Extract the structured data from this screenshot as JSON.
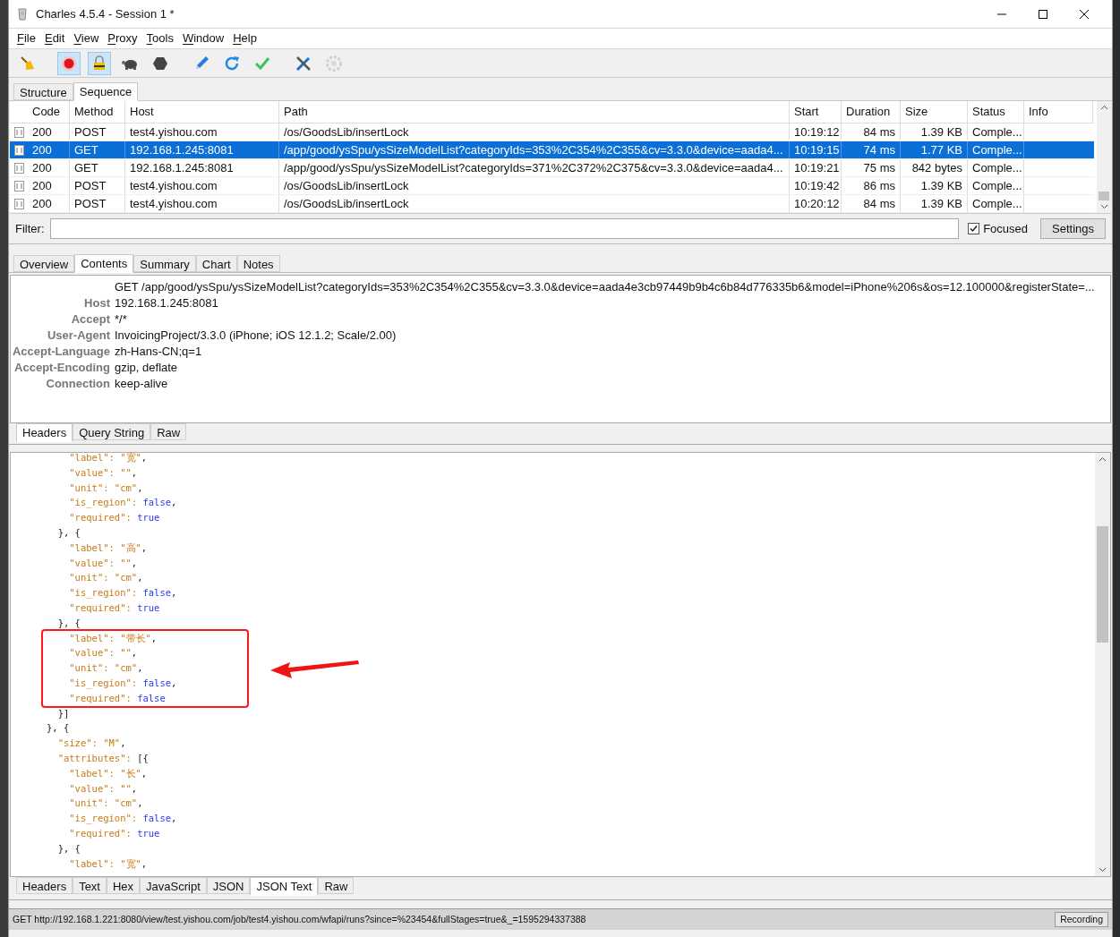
{
  "window": {
    "title": "Charles 4.5.4 - Session 1 *"
  },
  "menu": [
    {
      "label": "File"
    },
    {
      "label": "Edit"
    },
    {
      "label": "View"
    },
    {
      "label": "Proxy"
    },
    {
      "label": "Tools"
    },
    {
      "label": "Window"
    },
    {
      "label": "Help"
    }
  ],
  "toolbar": [
    {
      "kind": "broom",
      "selected": false,
      "disabled": false
    },
    {
      "kind": "record",
      "selected": true,
      "disabled": false
    },
    {
      "kind": "throttle",
      "selected": true,
      "disabled": false
    },
    {
      "kind": "turtle",
      "selected": false,
      "disabled": false
    },
    {
      "kind": "stop",
      "selected": false,
      "disabled": false
    },
    {
      "kind": "pen",
      "selected": false,
      "disabled": false
    },
    {
      "kind": "refresh",
      "selected": false,
      "disabled": false
    },
    {
      "kind": "check",
      "selected": false,
      "disabled": false
    },
    {
      "kind": "tools",
      "selected": false,
      "disabled": false
    },
    {
      "kind": "gear",
      "selected": false,
      "disabled": true
    }
  ],
  "view_tabs": [
    {
      "label": "Structure",
      "selected": false
    },
    {
      "label": "Sequence",
      "selected": true
    }
  ],
  "table": {
    "columns": [
      "Code",
      "Method",
      "Host",
      "Path",
      "Start",
      "Duration",
      "Size",
      "Status",
      "Info"
    ],
    "rows": [
      {
        "selected": false,
        "cells": [
          "200",
          "POST",
          "test4.yishou.com",
          "/os/GoodsLib/insertLock",
          "10:19:12",
          "84 ms",
          "1.39 KB",
          "Comple..."
        ]
      },
      {
        "selected": true,
        "cells": [
          "200",
          "GET",
          "192.168.1.245:8081",
          "/app/good/ysSpu/ysSizeModelList?categoryIds=353%2C354%2C355&cv=3.3.0&device=aada4...",
          "10:19:15",
          "74 ms",
          "1.77 KB",
          "Comple..."
        ]
      },
      {
        "selected": false,
        "cells": [
          "200",
          "GET",
          "192.168.1.245:8081",
          "/app/good/ysSpu/ysSizeModelList?categoryIds=371%2C372%2C375&cv=3.3.0&device=aada4...",
          "10:19:21",
          "75 ms",
          "842 bytes",
          "Comple..."
        ]
      },
      {
        "selected": false,
        "cells": [
          "200",
          "POST",
          "test4.yishou.com",
          "/os/GoodsLib/insertLock",
          "10:19:42",
          "86 ms",
          "1.39 KB",
          "Comple..."
        ]
      },
      {
        "selected": false,
        "cells": [
          "200",
          "POST",
          "test4.yishou.com",
          "/os/GoodsLib/insertLock",
          "10:20:12",
          "84 ms",
          "1.39 KB",
          "Comple..."
        ]
      }
    ]
  },
  "filter": {
    "label": "Filter:",
    "focused": {
      "label": "Focused",
      "checked": true
    },
    "settings_button": "Settings"
  },
  "detail_tabs": [
    {
      "label": "Overview",
      "selected": false
    },
    {
      "label": "Contents",
      "selected": true
    },
    {
      "label": "Summary",
      "selected": false
    },
    {
      "label": "Chart",
      "selected": false
    },
    {
      "label": "Notes",
      "selected": false
    }
  ],
  "request_headers": [
    {
      "value": "GET /app/good/ysSpu/ysSizeModelList?categoryIds=353%2C354%2C355&cv=3.3.0&device=aada4e3cb97449b9b4c6b84d776335b6&model=iPhone%206s&os=12.100000&registerState=..."
    },
    {
      "name": "Host",
      "value": "192.168.1.245:8081"
    },
    {
      "name": "Accept",
      "value": "*/*"
    },
    {
      "name": "User-Agent",
      "value": "InvoicingProject/3.3.0 (iPhone; iOS 12.1.2; Scale/2.00)"
    },
    {
      "name": "Accept-Language",
      "value": "zh-Hans-CN;q=1"
    },
    {
      "name": "Accept-Encoding",
      "value": "gzip, deflate"
    },
    {
      "name": "Connection",
      "value": "keep-alive"
    }
  ],
  "request_tabs": [
    {
      "label": "Headers",
      "selected": true
    },
    {
      "label": "Query String",
      "selected": false
    },
    {
      "label": "Raw",
      "selected": false
    }
  ],
  "code_blocks": [
    {
      "highlighted": false,
      "lines": [
        [
          {
            "kind": "str",
            "text": "    \"label\": \"宽\""
          },
          {
            "kind": "punct",
            "text": ","
          }
        ],
        [
          {
            "kind": "str",
            "text": "    \"value\": \"\""
          },
          {
            "kind": "punct",
            "text": ","
          }
        ],
        [
          {
            "kind": "str",
            "text": "    \"unit\": \"cm\""
          },
          {
            "kind": "punct",
            "text": ","
          }
        ],
        [
          {
            "kind": "str",
            "text": "    \"is_region\": "
          },
          {
            "kind": "bool",
            "text": "false"
          },
          {
            "kind": "punct",
            "text": ","
          }
        ],
        [
          {
            "kind": "str",
            "text": "    \"required\": "
          },
          {
            "kind": "bool",
            "text": "true"
          }
        ],
        [
          {
            "kind": "punct",
            "text": "  }, {"
          }
        ],
        [
          {
            "kind": "str",
            "text": "    \"label\": \"高\""
          },
          {
            "kind": "punct",
            "text": ","
          }
        ],
        [
          {
            "kind": "str",
            "text": "    \"value\": \"\""
          },
          {
            "kind": "punct",
            "text": ","
          }
        ],
        [
          {
            "kind": "str",
            "text": "    \"unit\": \"cm\""
          },
          {
            "kind": "punct",
            "text": ","
          }
        ],
        [
          {
            "kind": "str",
            "text": "    \"is_region\": "
          },
          {
            "kind": "bool",
            "text": "false"
          },
          {
            "kind": "punct",
            "text": ","
          }
        ],
        [
          {
            "kind": "str",
            "text": "    \"required\": "
          },
          {
            "kind": "bool",
            "text": "true"
          }
        ],
        [
          {
            "kind": "punct",
            "text": "  }, {"
          }
        ]
      ]
    },
    {
      "highlighted": true,
      "lines": [
        [
          {
            "kind": "str",
            "text": "    \"label\": \"带长\""
          },
          {
            "kind": "punct",
            "text": ","
          }
        ],
        [
          {
            "kind": "str",
            "text": "    \"value\": \"\""
          },
          {
            "kind": "punct",
            "text": ","
          }
        ],
        [
          {
            "kind": "str",
            "text": "    \"unit\": \"cm\""
          },
          {
            "kind": "punct",
            "text": ","
          }
        ],
        [
          {
            "kind": "str",
            "text": "    \"is_region\": "
          },
          {
            "kind": "bool",
            "text": "false"
          },
          {
            "kind": "punct",
            "text": ","
          }
        ],
        [
          {
            "kind": "str",
            "text": "    \"required\": "
          },
          {
            "kind": "bool",
            "text": "false"
          }
        ]
      ]
    },
    {
      "highlighted": false,
      "lines": [
        [
          {
            "kind": "punct",
            "text": "  }]"
          }
        ],
        [
          {
            "kind": "punct",
            "text": "}, {"
          }
        ],
        [
          {
            "kind": "str",
            "text": "  \"size\": \"M\""
          },
          {
            "kind": "punct",
            "text": ","
          }
        ],
        [
          {
            "kind": "str",
            "text": "  \"attributes\": "
          },
          {
            "kind": "punct",
            "text": "[{"
          }
        ],
        [
          {
            "kind": "str",
            "text": "    \"label\": \"长\""
          },
          {
            "kind": "punct",
            "text": ","
          }
        ],
        [
          {
            "kind": "str",
            "text": "    \"value\": \"\""
          },
          {
            "kind": "punct",
            "text": ","
          }
        ],
        [
          {
            "kind": "str",
            "text": "    \"unit\": \"cm\""
          },
          {
            "kind": "punct",
            "text": ","
          }
        ],
        [
          {
            "kind": "str",
            "text": "    \"is_region\": "
          },
          {
            "kind": "bool",
            "text": "false"
          },
          {
            "kind": "punct",
            "text": ","
          }
        ],
        [
          {
            "kind": "str",
            "text": "    \"required\": "
          },
          {
            "kind": "bool",
            "text": "true"
          }
        ],
        [
          {
            "kind": "punct",
            "text": "  }, {"
          }
        ],
        [
          {
            "kind": "str",
            "text": "    \"label\": \"宽\""
          },
          {
            "kind": "punct",
            "text": ","
          }
        ]
      ]
    }
  ],
  "response_tabs": [
    {
      "label": "Headers",
      "selected": false
    },
    {
      "label": "Text",
      "selected": false
    },
    {
      "label": "Hex",
      "selected": false
    },
    {
      "label": "JavaScript",
      "selected": false
    },
    {
      "label": "JSON",
      "selected": false
    },
    {
      "label": "JSON Text",
      "selected": true
    },
    {
      "label": "Raw",
      "selected": false
    }
  ],
  "status_bar": {
    "text": "GET http://192.168.1.221:8080/view/test.yishou.com/job/test4.yishou.com/wfapi/runs?since=%23454&fullStages=true&_=1595294337388",
    "recording": "Recording"
  }
}
